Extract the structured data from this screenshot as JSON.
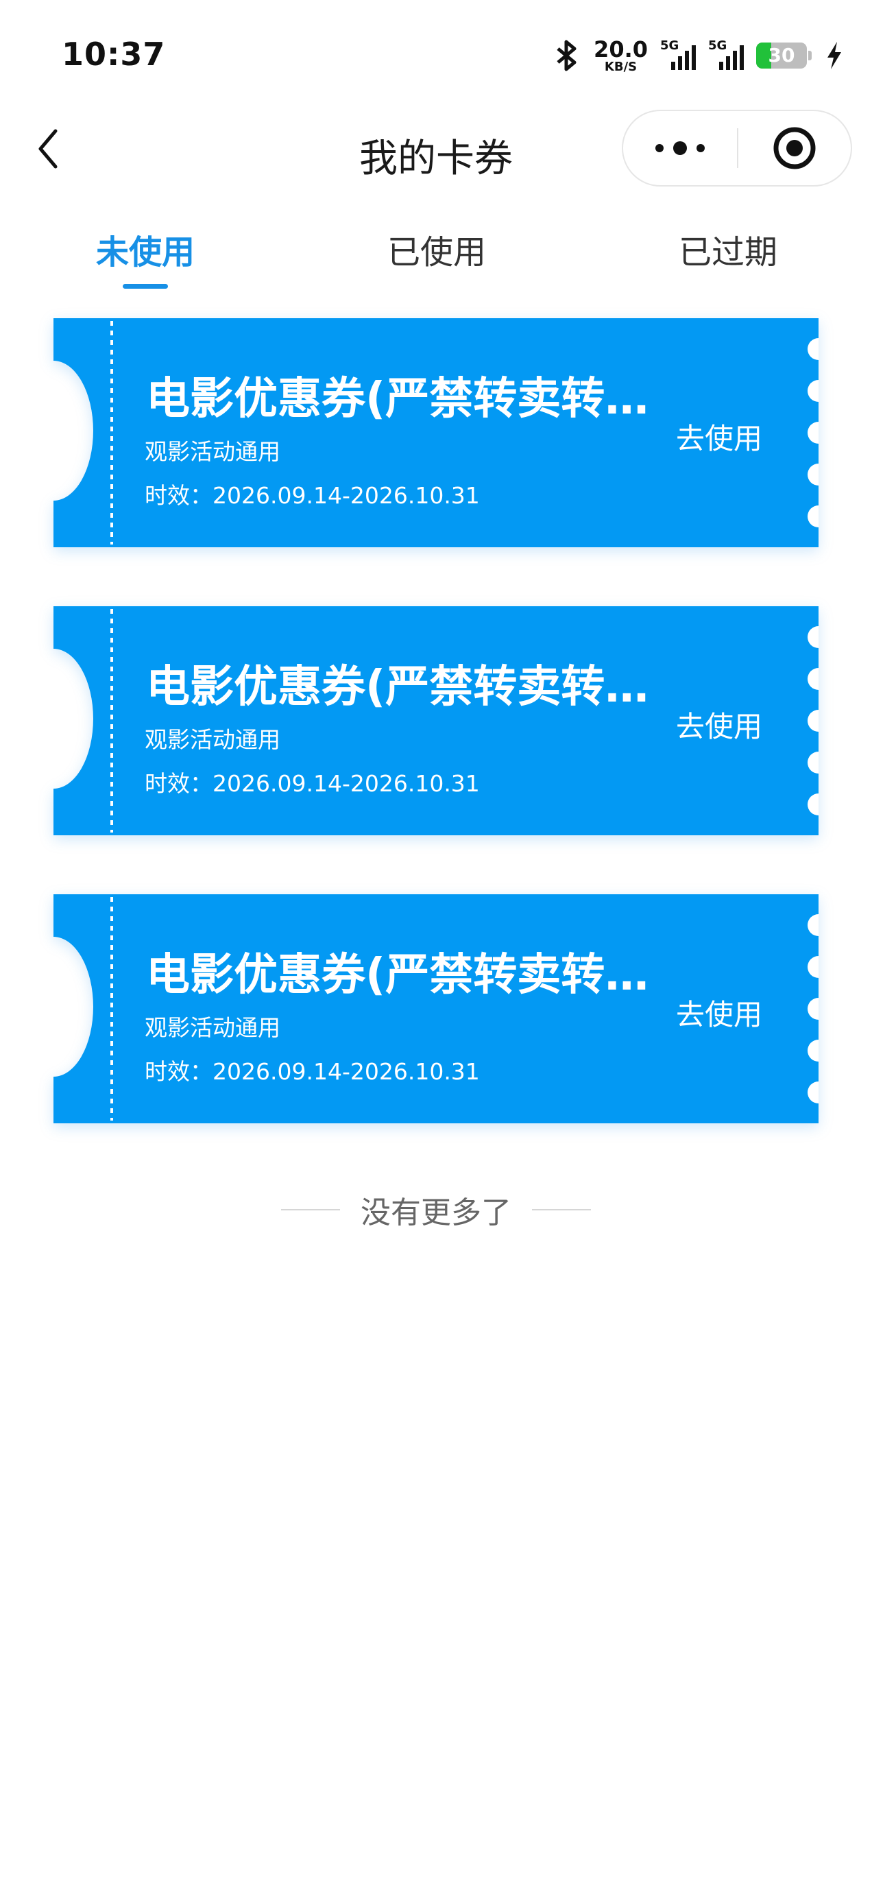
{
  "status_bar": {
    "time": "10:37",
    "net_speed_value": "20.0",
    "net_speed_unit": "KB/S",
    "signal_1_label": "5G",
    "signal_2_label": "5G",
    "battery_level": "30",
    "battery_fraction": 0.3,
    "icons": [
      "bluetooth-icon",
      "signal-icon",
      "battery-icon",
      "charging-icon"
    ]
  },
  "title_bar": {
    "title": "我的卡券",
    "back_icon": "chevron-left-icon",
    "more_icon": "more-dots-icon",
    "close_icon": "target-circle-icon"
  },
  "tabs": [
    {
      "label": "未使用",
      "active": true
    },
    {
      "label": "已使用",
      "active": false
    },
    {
      "label": "已过期",
      "active": false
    }
  ],
  "coupons": [
    {
      "title": "电影优惠券(严禁转卖转…",
      "desc": "观影活动通用",
      "validity": "时效：2026.09.14-2026.10.31",
      "action": "去使用"
    },
    {
      "title": "电影优惠券(严禁转卖转…",
      "desc": "观影活动通用",
      "validity": "时效：2026.09.14-2026.10.31",
      "action": "去使用"
    },
    {
      "title": "电影优惠券(严禁转卖转…",
      "desc": "观影活动通用",
      "validity": "时效：2026.09.14-2026.10.31",
      "action": "去使用"
    }
  ],
  "footer": {
    "no_more_text": "没有更多了"
  },
  "colors": {
    "accent": "#1790e6",
    "coupon_blue": "#0399f3",
    "battery_green": "#21c13a"
  }
}
